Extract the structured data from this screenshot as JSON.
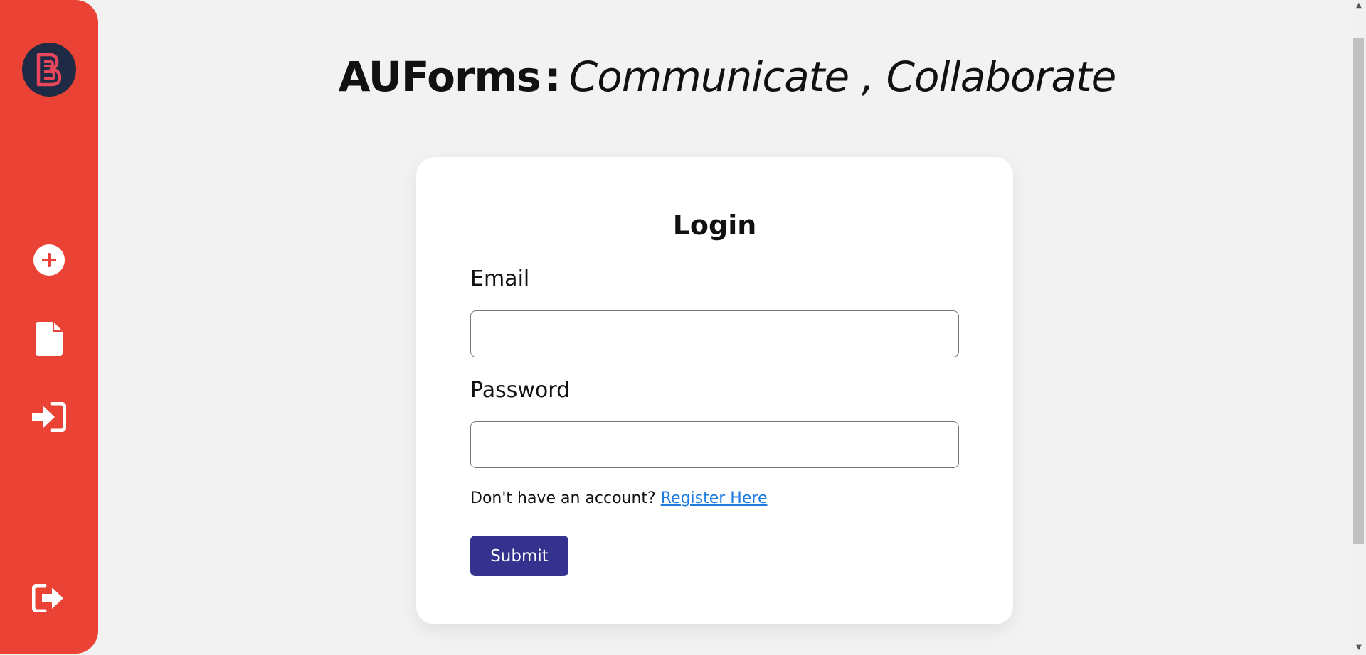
{
  "header": {
    "brand": "AUForms",
    "separator": ":",
    "tagline": "Communicate , Collaborate"
  },
  "sidebar": {
    "logo_icon": "b-logo-icon",
    "items": [
      {
        "icon": "plus-circle-icon"
      },
      {
        "icon": "file-icon"
      },
      {
        "icon": "sign-in-icon"
      }
    ],
    "bottom_item": {
      "icon": "sign-out-icon"
    }
  },
  "login": {
    "title": "Login",
    "email_label": "Email",
    "email_value": "",
    "password_label": "Password",
    "password_value": "",
    "register_prompt": "Don't have an account?",
    "register_link": "Register Here",
    "submit_label": "Submit"
  },
  "colors": {
    "sidebar": "#ea4335",
    "logo_bg": "#1f2a44",
    "submit": "#34318f",
    "link": "#1e7be0"
  }
}
